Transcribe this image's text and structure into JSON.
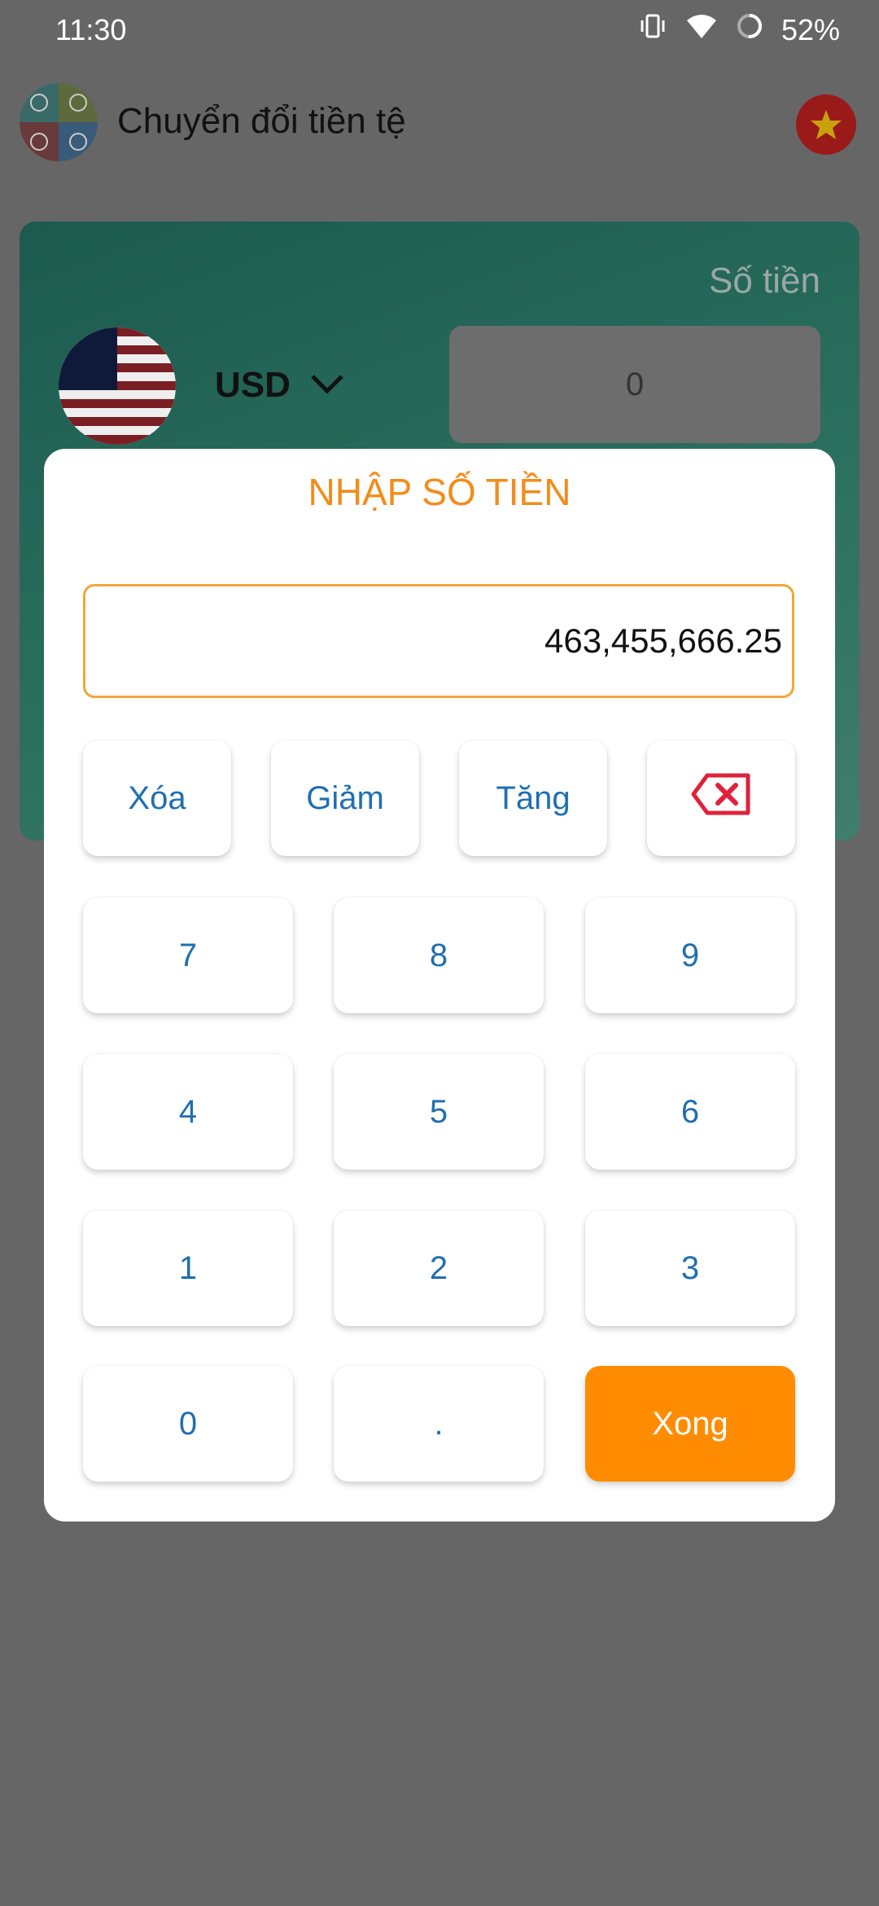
{
  "status_bar": {
    "time": "11:30",
    "battery": "52%",
    "icons": [
      "vibrate-icon",
      "wifi-icon",
      "battery-icon"
    ]
  },
  "header": {
    "title": "Chuyển đổi tiền tệ"
  },
  "converter": {
    "amount_label": "Số tiền",
    "currency": "USD",
    "amount_value": "0"
  },
  "dialog": {
    "title": "NHẬP SỐ TIỀN",
    "input_value": "463,455,666.25",
    "actions": {
      "clear": "Xóa",
      "decrease": "Giảm",
      "increase": "Tăng"
    },
    "keys": {
      "k7": "7",
      "k8": "8",
      "k9": "9",
      "k4": "4",
      "k5": "5",
      "k6": "6",
      "k1": "1",
      "k2": "2",
      "k3": "3",
      "k0": "0",
      "dot": "."
    },
    "done": "Xong"
  },
  "colors": {
    "accent": "#ff8c00",
    "key_text": "#1f6fb1",
    "title": "#f28c1a",
    "backspace": "#e0213b",
    "overlay": "#666666"
  }
}
